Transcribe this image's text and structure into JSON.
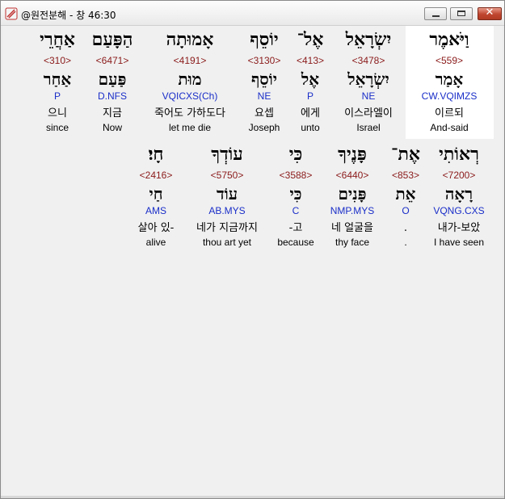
{
  "window": {
    "title": "@원전분해 - 창 46:30"
  },
  "rows": [
    {
      "words": [
        {
          "heb": "וַיֹּאמֶר",
          "strong": "<559>",
          "lemma": "אָמַר",
          "parse": "CW.VQIMZS",
          "kor": "이르되",
          "eng": "And-said",
          "highlight": true
        },
        {
          "heb": "יִשְׂרָאֵל",
          "strong": "<3478>",
          "lemma": "יִשְׂרָאֵל",
          "parse": "NE",
          "kor": "이스라엘이",
          "eng": "Israel"
        },
        {
          "heb": "אֶל־",
          "strong": "<413>",
          "lemma": "אֶל",
          "parse": "P",
          "kor": "에게",
          "eng": "unto"
        },
        {
          "heb": "יוֹסֵף",
          "strong": "<3130>",
          "lemma": "יוֹסֵף",
          "parse": "NE",
          "kor": "요셉",
          "eng": "Joseph"
        },
        {
          "heb": "אָמוּתָה",
          "strong": "<4191>",
          "lemma": "מוּת",
          "parse": "VQICXS(Ch)",
          "kor": "죽어도 가하도다",
          "eng": "let me die"
        },
        {
          "heb": "הַפָּעַם",
          "strong": "<6471>",
          "lemma": "פַּעַם",
          "parse": "D.NFS",
          "kor": "지금",
          "eng": "Now"
        },
        {
          "heb": "אַחֲרֵי",
          "strong": "<310>",
          "lemma": "אַחַר",
          "parse": "P",
          "kor": "으니",
          "eng": "since"
        }
      ]
    },
    {
      "words": [
        {
          "heb": "רְאוֹתִי",
          "strong": "<7200>",
          "lemma": "רָאָה",
          "parse": "VQNG.CXS",
          "kor": "내가-보았",
          "eng": "I have seen"
        },
        {
          "heb": "אֶת־",
          "strong": "<853>",
          "lemma": "אֵת",
          "parse": "O",
          "kor": ".",
          "eng": "."
        },
        {
          "heb": "פָּנֶיךָ",
          "strong": "<6440>",
          "lemma": "פָּנִים",
          "parse": "NMP.MYS",
          "kor": "네 얼굴을",
          "eng": "thy face"
        },
        {
          "heb": "כִּי",
          "strong": "<3588>",
          "lemma": "כִּי",
          "parse": "C",
          "kor": "-고",
          "eng": "because"
        },
        {
          "heb": "עוֹדְךָ",
          "strong": "<5750>",
          "lemma": "עוֹד",
          "parse": "AB.MYS",
          "kor": "네가 지금까지",
          "eng": "thou art yet"
        },
        {
          "heb": "חָי׃",
          "strong": "<2416>",
          "lemma": "חַי",
          "parse": "AMS",
          "kor": "살아 있-",
          "eng": "alive"
        }
      ]
    }
  ],
  "colors": {
    "strong": "#8b1a1a",
    "parse": "#1a2ec8",
    "highlight": "#ffffff"
  }
}
